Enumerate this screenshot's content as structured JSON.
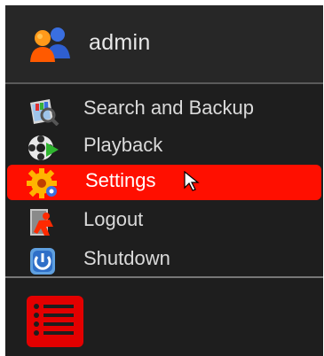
{
  "header": {
    "user": "admin",
    "icon": "users-icon"
  },
  "menu": {
    "items": [
      {
        "label": "Search and Backup",
        "icon": "search-backup-icon",
        "selected": false
      },
      {
        "label": "Playback",
        "icon": "playback-icon",
        "selected": false
      },
      {
        "label": "Settings",
        "icon": "settings-icon",
        "selected": true
      },
      {
        "label": "Logout",
        "icon": "logout-icon",
        "selected": false
      },
      {
        "label": "Shutdown",
        "icon": "power-icon",
        "selected": false
      }
    ]
  },
  "footer": {
    "icon": "list-icon"
  },
  "colors": {
    "background": "#1e1e1e",
    "selected": "#ff0f00",
    "footer_button": "#e30000"
  }
}
